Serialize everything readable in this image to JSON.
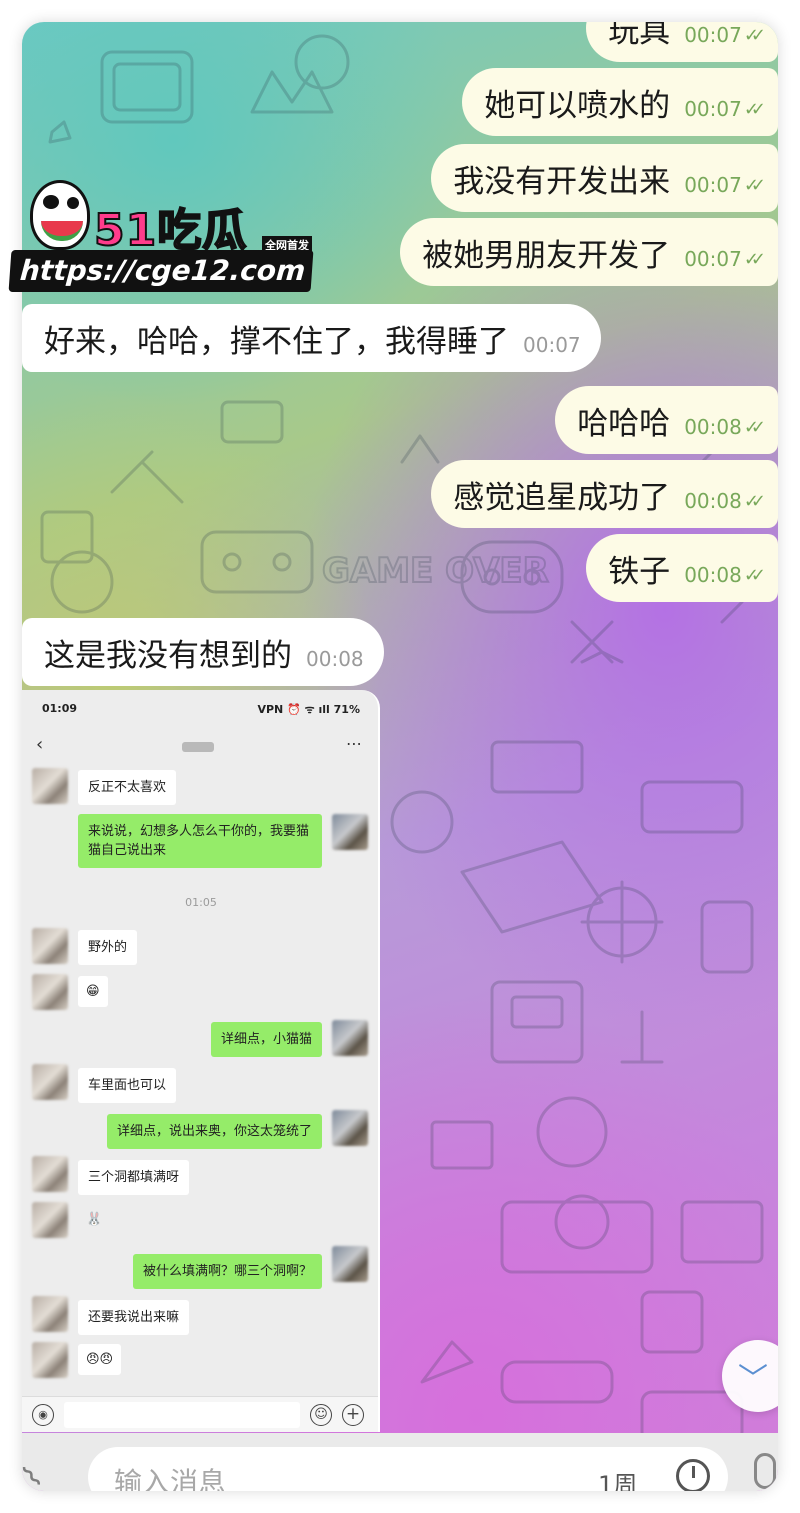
{
  "messages": [
    {
      "dir": "out",
      "text": "玩具",
      "time": "00:07"
    },
    {
      "dir": "out",
      "text": "她可以喷水的",
      "time": "00:07"
    },
    {
      "dir": "out",
      "text": "我没有开发出来",
      "time": "00:07"
    },
    {
      "dir": "out",
      "text": "被她男朋友开发了",
      "time": "00:07"
    },
    {
      "dir": "in",
      "text": "好来，哈哈，撑不住了，我得睡了",
      "time": "00:07"
    },
    {
      "dir": "out",
      "text": "哈哈哈",
      "time": "00:08"
    },
    {
      "dir": "out",
      "text": "感觉追星成功了",
      "time": "00:08"
    },
    {
      "dir": "out",
      "text": "铁子",
      "time": "00:08"
    },
    {
      "dir": "in",
      "text": "这是我没有想到的",
      "time": "00:08"
    }
  ],
  "read_check": "✓✓",
  "background_text": "GAME OVER",
  "embedded": {
    "status_time": "01:09",
    "status_icons": "VPN ⏰ ᯤ ıll",
    "battery": "71%",
    "back_icon": "chevron-left-icon",
    "more_icon": "⋯",
    "chat": [
      {
        "who": "them",
        "text": "反正不太喜欢"
      },
      {
        "who": "me",
        "text": "来说说，幻想多人怎么干你的，我要猫猫自己说出来"
      },
      {
        "who": "time",
        "text": "01:05"
      },
      {
        "who": "them",
        "text": "野外的"
      },
      {
        "who": "them",
        "text": "😁"
      },
      {
        "who": "me",
        "text": "详细点，小猫猫"
      },
      {
        "who": "them",
        "text": "车里面也可以"
      },
      {
        "who": "me",
        "text": "详细点，说出来奥，你这太笼统了"
      },
      {
        "who": "them",
        "text": "三个洞都填满呀"
      },
      {
        "who": "them",
        "text": "🐰"
      },
      {
        "who": "me",
        "text": "被什么填满啊？哪三个洞啊？"
      },
      {
        "who": "them",
        "text": "还要我说出来嘛"
      },
      {
        "who": "them",
        "text": "😠😠"
      }
    ],
    "input_icons": {
      "voice": "voice-icon",
      "emoji": "☺",
      "plus": "+"
    }
  },
  "composer": {
    "placeholder": "输入消息",
    "timer_label": "1周",
    "attach_icon": "paperclip-icon",
    "mic_icon": "microphone-icon"
  },
  "scroll_icon": "chevron-down-icon",
  "scroll_glyph": "﹀",
  "watermark": {
    "brand": "51吃瓜",
    "badge": "全网首发",
    "url": "https://cge12.com"
  },
  "colors": {
    "out_bubble": "#fdfbe6",
    "in_bubble": "#ffffff",
    "time_out": "#78a85a",
    "wechat_green": "#95ec69",
    "watermark_pink": "#ff3c8c"
  }
}
